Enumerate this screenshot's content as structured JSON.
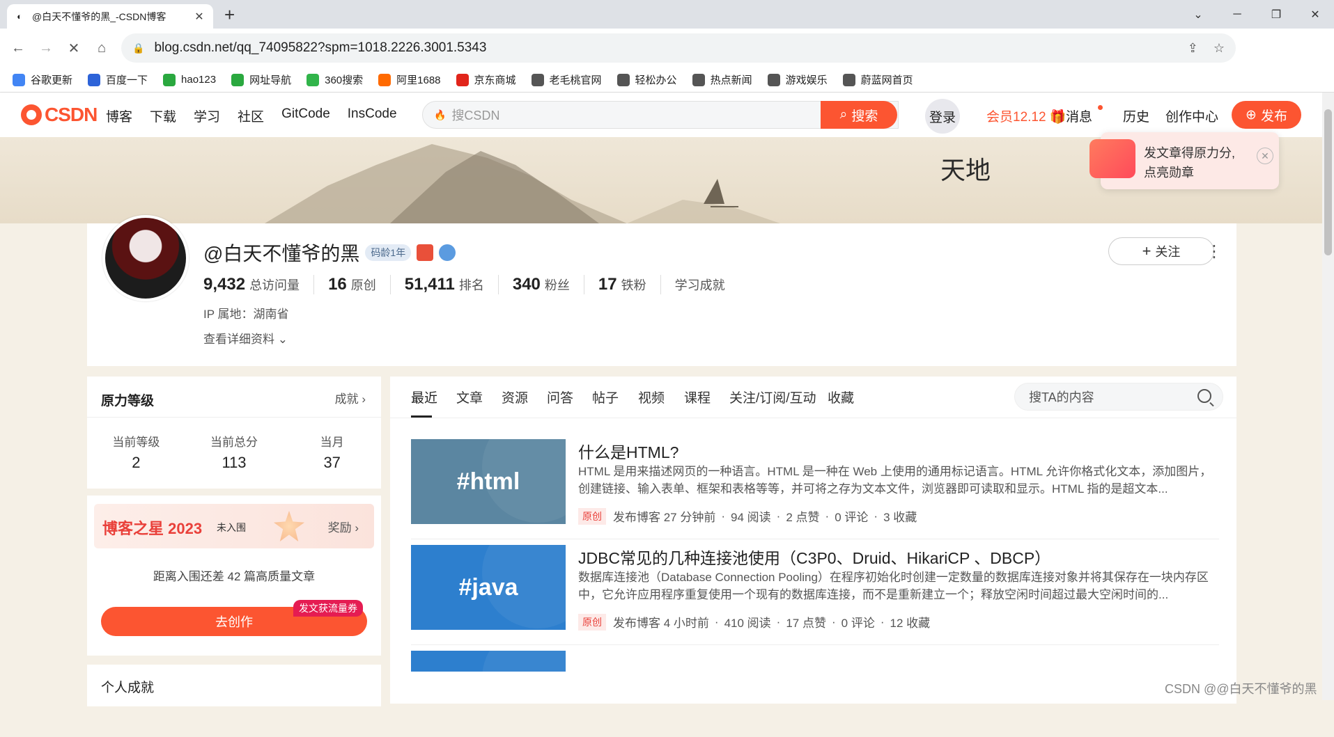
{
  "browser": {
    "tab_title": "@白天不懂爷的黑_-CSDN博客",
    "url": "blog.csdn.net/qq_74095822?spm=1018.2226.3001.5343",
    "bookmarks": [
      {
        "label": "谷歌更新",
        "color": "#4285f4"
      },
      {
        "label": "百度一下",
        "color": "#2d63d8"
      },
      {
        "label": "hao123",
        "color": "#2aa83f"
      },
      {
        "label": "网址导航",
        "color": "#2aa83f"
      },
      {
        "label": "360搜索",
        "color": "#31b44a"
      },
      {
        "label": "阿里1688",
        "color": "#ff6a00"
      },
      {
        "label": "京东商城",
        "color": "#e1251b"
      },
      {
        "label": "老毛桃官网",
        "color": "#555555"
      },
      {
        "label": "轻松办公",
        "color": "#555555"
      },
      {
        "label": "热点新闻",
        "color": "#555555"
      },
      {
        "label": "游戏娱乐",
        "color": "#555555"
      },
      {
        "label": "蔚蓝网首页",
        "color": "#555555"
      }
    ]
  },
  "csdn": {
    "logo": "CSDN",
    "nav": [
      "博客",
      "下载",
      "学习",
      "社区",
      "GitCode",
      "InsCode"
    ],
    "search_placeholder": "搜CSDN",
    "search_button": "搜索",
    "login": "登录",
    "member": "会员12.12",
    "messages": "消息",
    "history": "历史",
    "creator": "创作中心",
    "publish": "发布",
    "accent": "#fc5531"
  },
  "promo": {
    "line1": "发文章得原力分,",
    "line2": "点亮勋章"
  },
  "profile": {
    "name": "@白天不懂爷的黑",
    "code_age": "码龄1年",
    "stats": [
      {
        "value": "9,432",
        "label": "总访问量"
      },
      {
        "value": "16",
        "label": "原创"
      },
      {
        "value": "51,411",
        "label": "排名"
      },
      {
        "value": "340",
        "label": "粉丝"
      },
      {
        "value": "17",
        "label": "铁粉"
      }
    ],
    "achievement": "学习成就",
    "ip": "IP 属地：湖南省",
    "detail": "查看详细资料",
    "follow": "关注"
  },
  "level_card": {
    "title": "原力等级",
    "link": "成就",
    "cols": [
      {
        "label": "当前等级",
        "value": "2"
      },
      {
        "label": "当前总分",
        "value": "113"
      },
      {
        "label": "当月",
        "value": "37"
      }
    ]
  },
  "star_card": {
    "title": "博客之星 2023",
    "status": "未入围",
    "link": "奖励",
    "message": "距离入围还差 42 篇高质量文章",
    "button": "去创作",
    "tag": "发文获流量券"
  },
  "personal": {
    "title": "个人成就"
  },
  "content_tabs": [
    "最近",
    "文章",
    "资源",
    "问答",
    "帖子",
    "视频",
    "课程",
    "关注/订阅/互动",
    "收藏"
  ],
  "content_search": "搜TA的内容",
  "articles": [
    {
      "thumb": "#html",
      "thumb_color": "#5b86a1",
      "title": "什么是HTML?",
      "desc": "HTML 是用来描述网页的一种语言。HTML 是一种在 Web 上使用的通用标记语言。HTML 允许你格式化文本，添加图片，创建链接、输入表单、框架和表格等等，并可将之存为文本文件，浏览器即可读取和显示。HTML 指的是超文本...",
      "orig": "原创",
      "posted": "发布博客 27 分钟前",
      "reads": "94 阅读",
      "likes": "2 点赞",
      "comments": "0 评论",
      "favs": "3 收藏"
    },
    {
      "thumb": "#java",
      "thumb_color": "#2d7fce",
      "title": "JDBC常见的几种连接池使用（C3P0、Druid、HikariCP 、DBCP）",
      "desc": "数据库连接池（Database Connection Pooling）在程序初始化时创建一定数量的数据库连接对象并将其保存在一块内存区中，它允许应用程序重复使用一个现有的数据库连接，而不是重新建立一个；释放空闲时间超过最大空闲时间的...",
      "orig": "原创",
      "posted": "发布博客 4 小时前",
      "reads": "410 阅读",
      "likes": "17 点赞",
      "comments": "0 评论",
      "favs": "12 收藏"
    }
  ],
  "watermark": "CSDN @@白天不懂爷的黑"
}
